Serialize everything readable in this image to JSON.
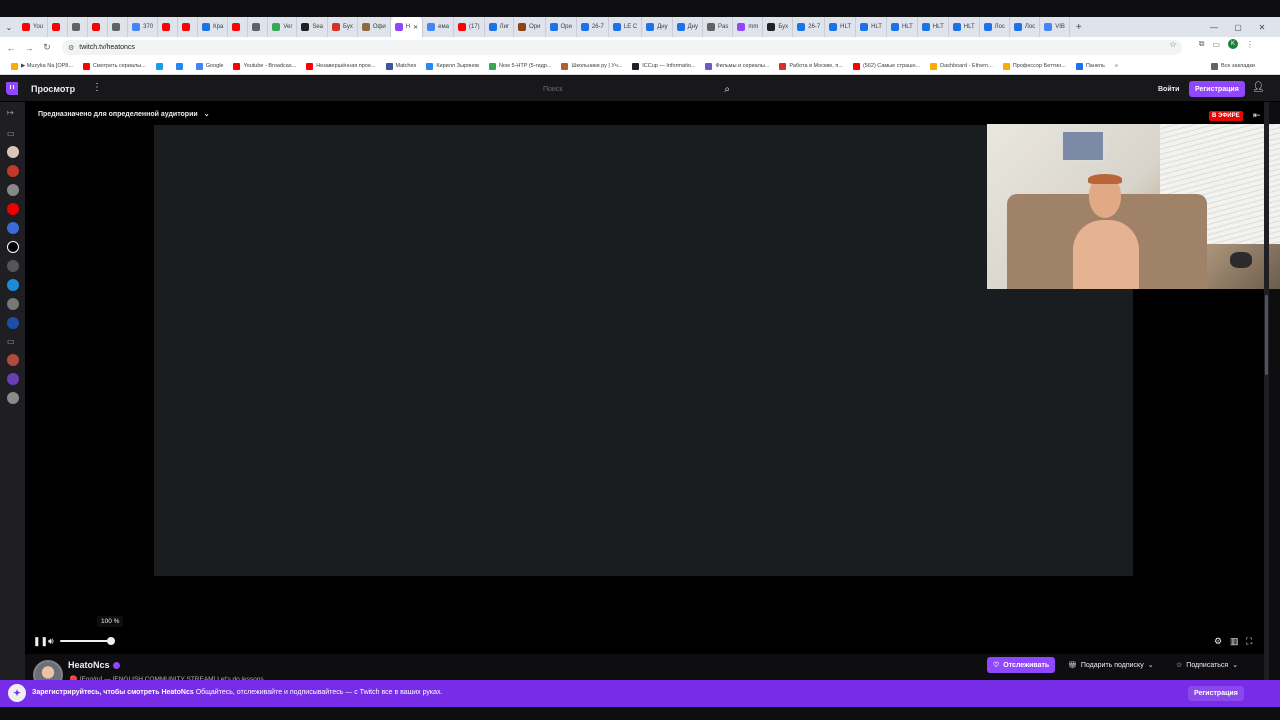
{
  "browser": {
    "tabs": [
      {
        "label": "You",
        "color": "#ff0000"
      },
      {
        "label": "",
        "color": "#ff0000"
      },
      {
        "label": "",
        "color": "#5f6368"
      },
      {
        "label": "",
        "color": "#ff0000"
      },
      {
        "label": "",
        "color": "#5f6368"
      },
      {
        "label": "370",
        "color": "#4285f4"
      },
      {
        "label": "",
        "color": "#ff0000"
      },
      {
        "label": "",
        "color": "#ff0000"
      },
      {
        "label": "Кра",
        "color": "#1a73e8"
      },
      {
        "label": "",
        "color": "#ff0000"
      },
      {
        "label": "",
        "color": "#5f6368"
      },
      {
        "label": "Ver",
        "color": "#34a853"
      },
      {
        "label": "Sea",
        "color": "#202124"
      },
      {
        "label": "Бух",
        "color": "#d93025"
      },
      {
        "label": "Офи",
        "color": "#8b6c42"
      },
      {
        "label": "H",
        "color": "#9146ff",
        "active": true
      },
      {
        "label": "ема",
        "color": "#4285f4"
      },
      {
        "label": "(17)",
        "color": "#ff0000"
      },
      {
        "label": "Лиг",
        "color": "#1a73e8"
      },
      {
        "label": "Ори",
        "color": "#8b4513"
      },
      {
        "label": "Ори",
        "color": "#1a73e8"
      },
      {
        "label": "26-7",
        "color": "#1a73e8"
      },
      {
        "label": "LE C",
        "color": "#1a73e8"
      },
      {
        "label": "Дну",
        "color": "#1a73e8"
      },
      {
        "label": "Дну",
        "color": "#1a73e8"
      },
      {
        "label": "Pas",
        "color": "#5f6368"
      },
      {
        "label": "mm",
        "color": "#9146ff"
      },
      {
        "label": "Бух",
        "color": "#202124"
      },
      {
        "label": "26-7",
        "color": "#1a73e8"
      },
      {
        "label": "HLT",
        "color": "#1a73e8"
      },
      {
        "label": "HLT",
        "color": "#1a73e8"
      },
      {
        "label": "HLT",
        "color": "#1a73e8"
      },
      {
        "label": "HLT",
        "color": "#1a73e8"
      },
      {
        "label": "HLT",
        "color": "#1a73e8"
      },
      {
        "label": "Лос",
        "color": "#1a73e8"
      },
      {
        "label": "Лос",
        "color": "#1a73e8"
      },
      {
        "label": "VIB",
        "color": "#4285f4"
      }
    ],
    "url": "twitch.tv/heatoncs",
    "profile_letter": "K",
    "bookmarks": [
      {
        "label": "▶ Muzyka Na [OP8...",
        "color": "#f9ab00"
      },
      {
        "label": "Смотреть сериалы...",
        "color": "#ff0000"
      },
      {
        "label": "",
        "color": "#1d9bf0"
      },
      {
        "label": "",
        "color": "#2787f5"
      },
      {
        "label": "Google",
        "color": "#4285f4"
      },
      {
        "label": "Youtube - Broadcas...",
        "color": "#ff0000"
      },
      {
        "label": "Незавершённая прое...",
        "color": "#ff0000"
      },
      {
        "label": "Matches",
        "color": "#3b5998"
      },
      {
        "label": "Кирилл Зырянов",
        "color": "#2787f5"
      },
      {
        "label": "Now 5-HTP (5-гидр...",
        "color": "#34a853"
      },
      {
        "label": "Школьники ру | Уч...",
        "color": "#b06030"
      },
      {
        "label": "ICCup — Informatio...",
        "color": "#202124"
      },
      {
        "label": "Фильмы и сериалы...",
        "color": "#6a5acd"
      },
      {
        "label": "Работа в Москве, п...",
        "color": "#d93025"
      },
      {
        "label": "(562) Самые страшн...",
        "color": "#ff0000"
      },
      {
        "label": "Dashboard - Ethern...",
        "color": "#f9ab00"
      },
      {
        "label": "Профессор Беттин...",
        "color": "#f9ab00"
      },
      {
        "label": "Панель",
        "color": "#1a73e8"
      },
      {
        "label": "»",
        "color": ""
      },
      {
        "label": "Все закладки",
        "color": "#5f6368"
      }
    ]
  },
  "twitch": {
    "browse_label": "Просмотр",
    "search_placeholder": "Поиск",
    "login_label": "Войти",
    "signup_label": "Регистрация",
    "audience_label": "Предназначено для определенной аудитории",
    "live_badge": "В ЭФИРЕ",
    "volume_label": "100 %",
    "volume": 1.0,
    "channel_name": "HeatoNcs",
    "stream_title": " 🔴 [Eng/ru] — [ENGLISH COMMUNITY STREAM] Let's do lessons...",
    "follow_label": "Отслеживать",
    "gift_label": "Подарить подписку",
    "subscribe_label": "Подписаться",
    "banner": {
      "bold_text": "Зарегистрируйтесь, чтобы смотреть HeatoNcs",
      "text": " Общайтесь, отслеживайте и подписывайтесь — с Twitch все в ваших руках.",
      "button_label": "Регистрация"
    }
  }
}
